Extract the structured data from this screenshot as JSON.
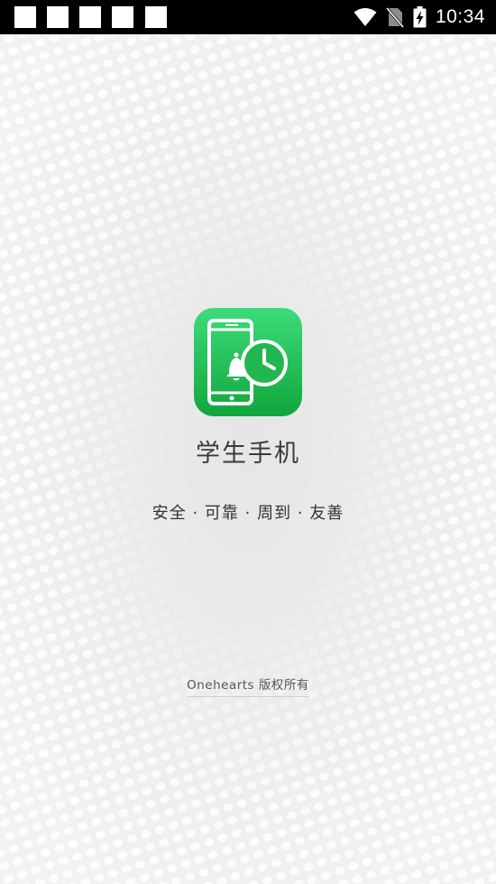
{
  "status_bar": {
    "time": "10:34",
    "notification_icons": [
      "notification-icon",
      "notification-icon",
      "notification-icon",
      "notification-icon",
      "notification-icon"
    ],
    "icons": [
      "wifi-icon",
      "no-sim-icon",
      "battery-charging-icon"
    ]
  },
  "splash": {
    "app_name": "学生手机",
    "slogan": "安全 · 可靠 · 周到 · 友善",
    "copyright": "Onehearts  版权所有"
  },
  "colors": {
    "icon_green_top": "#3ddc7a",
    "icon_green_bottom": "#12a53c",
    "background": "#efefef"
  }
}
